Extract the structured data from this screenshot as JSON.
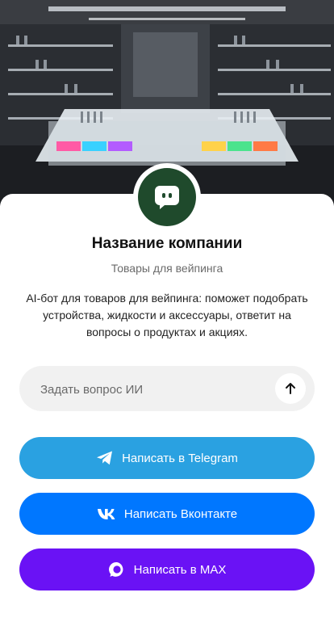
{
  "company": {
    "name": "Название компании",
    "category": "Товары для вейпинга",
    "description": "AI-бот для товаров для вейпинга: поможет подобрать устройства, жидкости и аксессуары, ответит на вопросы о продуктах и акциях."
  },
  "ask": {
    "placeholder": "Задать вопрос ИИ"
  },
  "buttons": {
    "telegram": "Написать в Telegram",
    "vk": "Написать Вконтакте",
    "max": "Написать в MAX"
  },
  "icons": {
    "logo": "chat-bot-icon",
    "send": "arrow-up-icon",
    "telegram": "telegram-icon",
    "vk": "vk-icon",
    "max": "max-icon"
  },
  "colors": {
    "logo_bg": "#1f4a2c",
    "telegram": "#2aa1e1",
    "vk": "#0077ff",
    "max": "#6a12f5",
    "input_bg": "#f1f1f1"
  }
}
